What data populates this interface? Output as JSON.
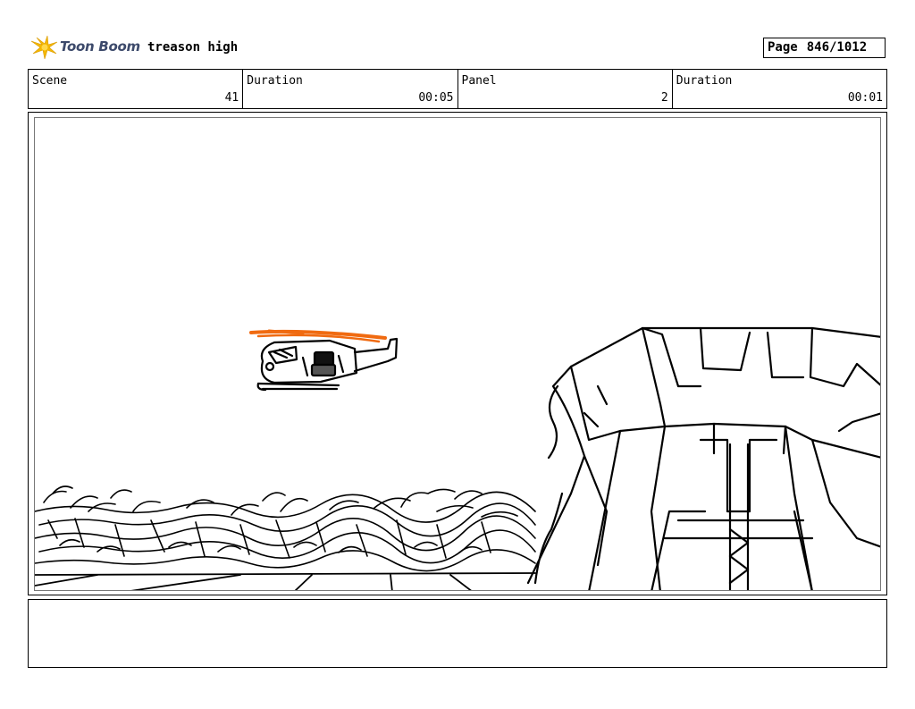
{
  "header": {
    "logo_text": "Toon Boom",
    "project_title": "treason high",
    "page_label": "Page",
    "page_value": "846/1012"
  },
  "info": {
    "scene_label": "Scene",
    "scene_value": "41",
    "scene_duration_label": "Duration",
    "scene_duration_value": "00:05",
    "panel_label": "Panel",
    "panel_value": "2",
    "panel_duration_label": "Duration",
    "panel_duration_value": "00:01"
  },
  "colors": {
    "logo_star": "#f5b800",
    "logo_text": "#3d4a6b",
    "rotor": "#f06a10"
  },
  "notes": {
    "text": ""
  }
}
